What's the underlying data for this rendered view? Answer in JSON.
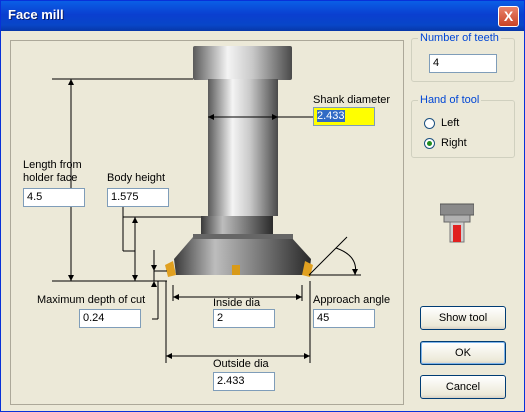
{
  "window": {
    "title": "Face mill",
    "close_label": "X"
  },
  "fields": {
    "shank_diameter": {
      "label": "Shank diameter",
      "value": "2.433"
    },
    "length_from_holder_face": {
      "label_line1": "Length from",
      "label_line2": "holder face",
      "value": "4.5"
    },
    "body_height": {
      "label": "Body height",
      "value": "1.575"
    },
    "max_depth_of_cut": {
      "label": "Maximum depth of cut",
      "value": "0.24"
    },
    "inside_dia": {
      "label": "Inside dia",
      "value": "2"
    },
    "approach_angle": {
      "label": "Approach angle",
      "value": "45"
    },
    "outside_dia": {
      "label": "Outside dia",
      "value": "2.433"
    }
  },
  "teeth": {
    "legend": "Number of teeth",
    "value": "4"
  },
  "hand": {
    "legend": "Hand of tool",
    "options": [
      "Left",
      "Right"
    ],
    "selected": "Right"
  },
  "buttons": {
    "show_tool": "Show tool",
    "ok": "OK",
    "cancel": "Cancel"
  },
  "icons": {
    "close": "close-icon",
    "preview": "tool-preview-icon"
  },
  "colors": {
    "titlebar": "#0a3fd0",
    "highlight_field": "#ffff00",
    "selection": "#316ac5",
    "legend": "#0046d5",
    "insert": "#e0a020"
  }
}
